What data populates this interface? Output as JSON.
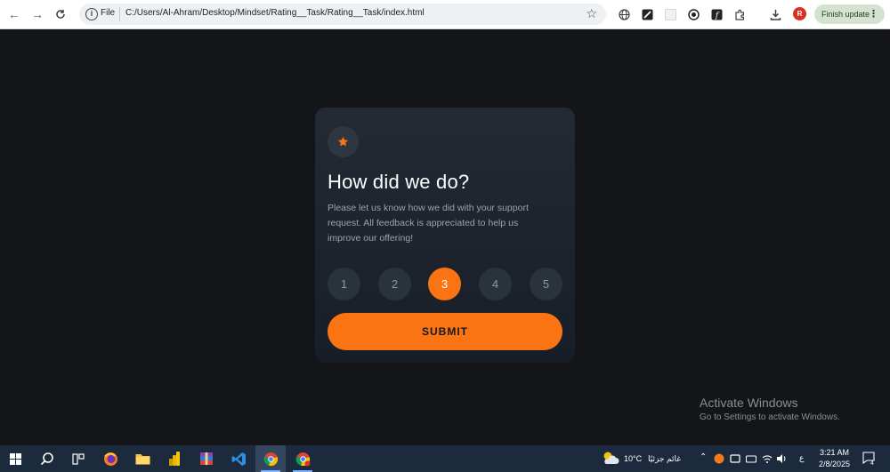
{
  "browser": {
    "protocol_label": "File",
    "url": "C:/Users/Al-Ahram/Desktop/Mindset/Rating__Task/Rating__Task/index.html",
    "profile_initial": "R",
    "finish_update_label": "Finish update"
  },
  "card": {
    "title": "How did we do?",
    "description": "Please let us know how we did with your support request. All feedback is appreciated to help us improve our offering!",
    "ratings": [
      "1",
      "2",
      "3",
      "4",
      "5"
    ],
    "selected_rating": "3",
    "submit_label": "SUBMIT"
  },
  "watermark": {
    "title": "Activate Windows",
    "subtitle": "Go to Settings to activate Windows."
  },
  "taskbar": {
    "weather_temp": "10°C",
    "weather_text": "غائم جزئيًا",
    "language": "ع",
    "time": "3:21 AM",
    "date": "2/8/2025",
    "notification_count": "4"
  },
  "colors": {
    "accent": "#fb7413",
    "card_bg": "#232a34",
    "page_bg": "#131518"
  }
}
